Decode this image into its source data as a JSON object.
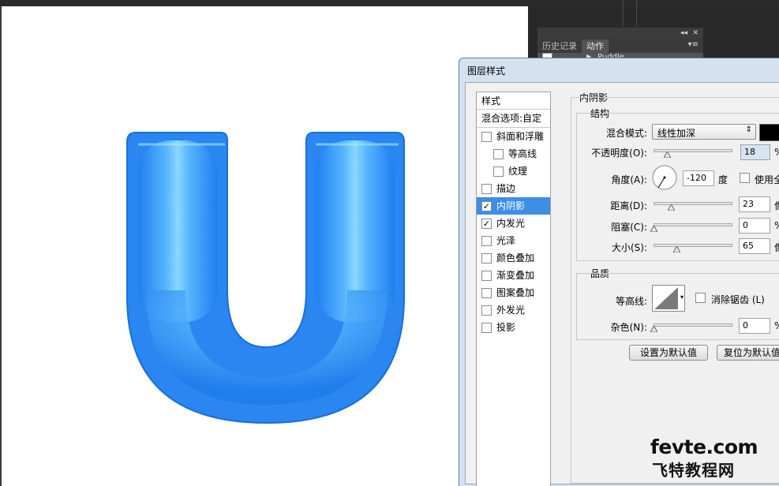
{
  "canvas": {
    "glyph": "U",
    "glyph_color": "#2e8cf2",
    "glyph_highlight": "#9fe4ff"
  },
  "history_panel": {
    "tabs": [
      "历史记录",
      "动作"
    ],
    "active_tab": "动作",
    "row_label": "Puddle",
    "collapse_glyph": "◂◂",
    "close_glyph": "✕",
    "menu_glyph": "▾≡"
  },
  "dialog": {
    "title": "图层样式",
    "styles_header": "样式",
    "blending_options": "混合选项:自定",
    "styles": [
      {
        "label": "斜面和浮雕",
        "checked": false,
        "indent": false,
        "selected": false
      },
      {
        "label": "等高线",
        "checked": false,
        "indent": true,
        "selected": false
      },
      {
        "label": "纹理",
        "checked": false,
        "indent": true,
        "selected": false
      },
      {
        "label": "描边",
        "checked": false,
        "indent": false,
        "selected": false
      },
      {
        "label": "内阴影",
        "checked": true,
        "indent": false,
        "selected": true
      },
      {
        "label": "内发光",
        "checked": true,
        "indent": false,
        "selected": false
      },
      {
        "label": "光泽",
        "checked": false,
        "indent": false,
        "selected": false
      },
      {
        "label": "颜色叠加",
        "checked": false,
        "indent": false,
        "selected": false
      },
      {
        "label": "渐变叠加",
        "checked": false,
        "indent": false,
        "selected": false
      },
      {
        "label": "图案叠加",
        "checked": false,
        "indent": false,
        "selected": false
      },
      {
        "label": "外发光",
        "checked": false,
        "indent": false,
        "selected": false
      },
      {
        "label": "投影",
        "checked": false,
        "indent": false,
        "selected": false
      }
    ],
    "section_title": "内阴影",
    "structure": {
      "title": "结构",
      "blend_mode_label": "混合模式:",
      "blend_mode_value": "线性加深",
      "color": "#000000",
      "opacity_label": "不透明度(O):",
      "opacity_value": "18",
      "opacity_unit": "%",
      "angle_label": "角度(A):",
      "angle_value": "-120",
      "angle_unit": "度",
      "global_light_label": "使用全局",
      "distance_label": "距离(D):",
      "distance_value": "23",
      "distance_unit": "像素",
      "choke_label": "阻塞(C):",
      "choke_value": "0",
      "choke_unit": "%",
      "size_label": "大小(S):",
      "size_value": "65",
      "size_unit": "像素"
    },
    "quality": {
      "title": "品质",
      "contour_label": "等高线:",
      "antialias_label": "消除锯齿 (L)",
      "noise_label": "杂色(N):",
      "noise_value": "0",
      "noise_unit": "%"
    },
    "buttons": {
      "set_default": "设置为默认值",
      "reset_default": "复位为默认值"
    }
  },
  "watermark": {
    "line1": "fevte.com",
    "line2": "飞特教程网"
  }
}
